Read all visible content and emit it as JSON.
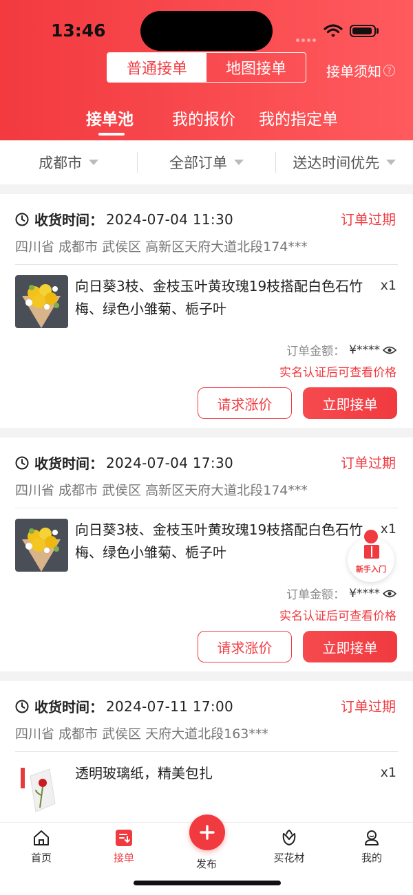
{
  "status_bar": {
    "time": "13:46"
  },
  "header": {
    "mode_toggle": [
      {
        "label": "普通接单",
        "active": true
      },
      {
        "label": "地图接单",
        "active": false
      }
    ],
    "notice_label": "接单须知",
    "notice_icon": "question-circle-icon",
    "tabs": [
      {
        "label": "接单池",
        "active": true
      },
      {
        "label": "我的报价",
        "active": false
      },
      {
        "label": "我的指定单",
        "active": false
      }
    ]
  },
  "filters": [
    {
      "label": "成都市"
    },
    {
      "label": "全部订单"
    },
    {
      "label": "送达时间优先"
    }
  ],
  "colors": {
    "accent": "#f03a40",
    "header_start": "#f23a3f",
    "header_end": "#ff5a5e"
  },
  "orders": [
    {
      "receive_label": "收货时间：",
      "receive_time": "2024-07-04 11:30",
      "status": "订单过期",
      "address": "四川省 成都市 武侯区 高新区天府大道北段174***",
      "product_name": "向日葵3枝、金枝玉叶黄玫瑰19枝搭配白色石竹梅、绿色小雏菊、栀子叶",
      "quantity": "x1",
      "amount_label": "订单金额：",
      "amount_value": "¥****",
      "verify_hint": "实名认证后可查看价格",
      "raise_button": "请求涨价",
      "accept_button": "立即接单"
    },
    {
      "receive_label": "收货时间：",
      "receive_time": "2024-07-04 17:30",
      "status": "订单过期",
      "address": "四川省 成都市 武侯区 高新区天府大道北段174***",
      "product_name": "向日葵3枝、金枝玉叶黄玫瑰19枝搭配白色石竹梅、绿色小雏菊、栀子叶",
      "quantity": "x1",
      "amount_label": "订单金额：",
      "amount_value": "¥****",
      "verify_hint": "实名认证后可查看价格",
      "raise_button": "请求涨价",
      "accept_button": "立即接单"
    },
    {
      "receive_label": "收货时间：",
      "receive_time": "2024-07-11 17:00",
      "status": "订单过期",
      "address": "四川省 成都市 武侯区 天府大道北段163***",
      "product_name": "透明玻璃纸，精美包扎",
      "quantity": "x1"
    }
  ],
  "floating_guide": {
    "label": "新手入门",
    "icon": "book-icon"
  },
  "tabbar": [
    {
      "label": "首页",
      "icon": "home-icon",
      "active": false
    },
    {
      "label": "接单",
      "icon": "orders-icon",
      "active": true
    },
    {
      "label": "发布",
      "icon": "plus-icon",
      "active": false
    },
    {
      "label": "买花材",
      "icon": "flower-icon",
      "active": false
    },
    {
      "label": "我的",
      "icon": "profile-icon",
      "active": false
    }
  ]
}
